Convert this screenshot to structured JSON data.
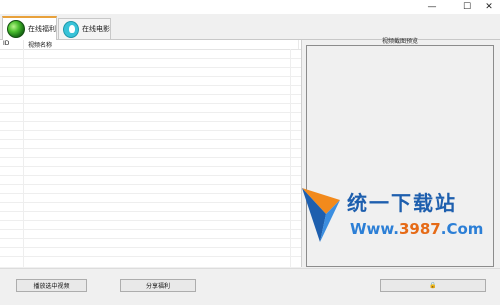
{
  "window": {
    "controls": {
      "minimize": "—",
      "maximize": "☐",
      "close": "✕"
    }
  },
  "tabs": [
    {
      "label": "在线福利",
      "icon": "globe-icon",
      "active": true
    },
    {
      "label": "在线电影",
      "icon": "film-icon",
      "active": false
    }
  ],
  "list": {
    "columns": [
      "ID",
      "视频名称"
    ],
    "rows": []
  },
  "preview": {
    "title": "视频截图预览"
  },
  "buttons": {
    "play_selected": "播放选中视频",
    "share": "分享福利",
    "lock_label": "🔒"
  },
  "watermark": {
    "brand": "统一下载站",
    "url_prefix": "Www.",
    "url_number": "3987",
    "url_suffix": ".Com"
  }
}
